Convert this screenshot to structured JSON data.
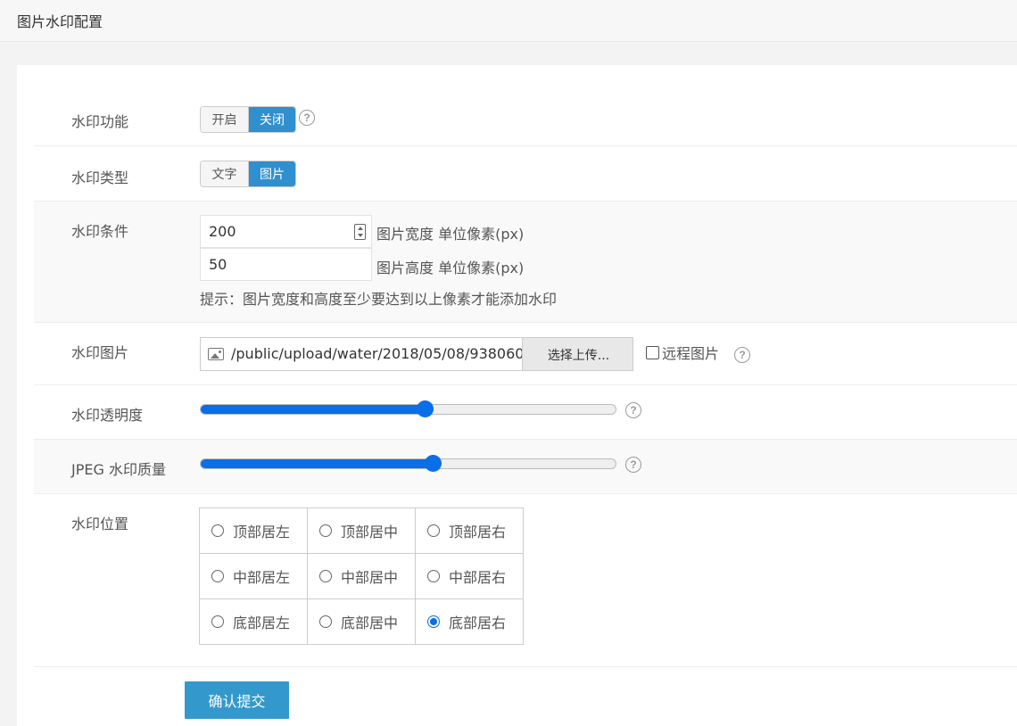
{
  "header": {
    "title": "图片水印配置"
  },
  "watermark_enable": {
    "label": "水印功能",
    "options": [
      "开启",
      "关闭"
    ],
    "selected": "关闭"
  },
  "watermark_type": {
    "label": "水印类型",
    "options": [
      "文字",
      "图片"
    ],
    "selected": "图片"
  },
  "watermark_condition": {
    "label": "水印条件",
    "width_value": "200",
    "width_unit": "图片宽度 单位像素(px)",
    "height_value": "50",
    "height_unit": "图片高度 单位像素(px)",
    "hint": "提示：图片宽度和高度至少要达到以上像素才能添加水印"
  },
  "watermark_image": {
    "label": "水印图片",
    "path": "/public/upload/water/2018/05/08/938060",
    "upload_label": "选择上传...",
    "remote_label": "远程图片",
    "remote_checked": false
  },
  "watermark_opacity": {
    "label": "水印透明度",
    "value": 0.54
  },
  "jpeg_quality": {
    "label": "JPEG 水印质量",
    "value": 0.56
  },
  "watermark_position": {
    "label": "水印位置",
    "options": [
      "顶部居左",
      "顶部居中",
      "顶部居右",
      "中部居左",
      "中部居中",
      "中部居右",
      "底部居左",
      "底部居中",
      "底部居右"
    ],
    "selected": "底部居右"
  },
  "submit_label": "确认提交",
  "icons": [
    "question-icon",
    "image-icon",
    "spinner-icon"
  ]
}
